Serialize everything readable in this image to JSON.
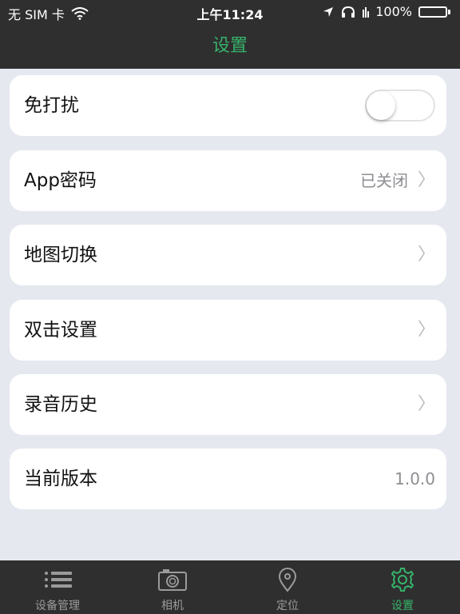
{
  "status_bar": {
    "carrier": "无 SIM 卡",
    "time": "上午11:24",
    "battery_percent": "100%",
    "battery_color": "#36e55a"
  },
  "nav": {
    "title": "设置"
  },
  "settings": {
    "do_not_disturb": {
      "label": "免打扰",
      "enabled": false
    },
    "app_password": {
      "label": "App密码",
      "value": "已关闭"
    },
    "map_switch": {
      "label": "地图切换"
    },
    "double_tap": {
      "label": "双击设置"
    },
    "recording_history": {
      "label": "录音历史"
    },
    "version": {
      "label": "当前版本",
      "value": "1.0.0"
    }
  },
  "tabs": [
    {
      "label": "设备管理",
      "icon": "list-icon",
      "active": false
    },
    {
      "label": "相机",
      "icon": "camera-icon",
      "active": false
    },
    {
      "label": "定位",
      "icon": "location-pin-icon",
      "active": false
    },
    {
      "label": "设置",
      "icon": "gear-icon",
      "active": true
    }
  ],
  "colors": {
    "accent": "#36b36a",
    "bar_background": "#2f2f2f",
    "page_background": "#e6e8f0"
  }
}
